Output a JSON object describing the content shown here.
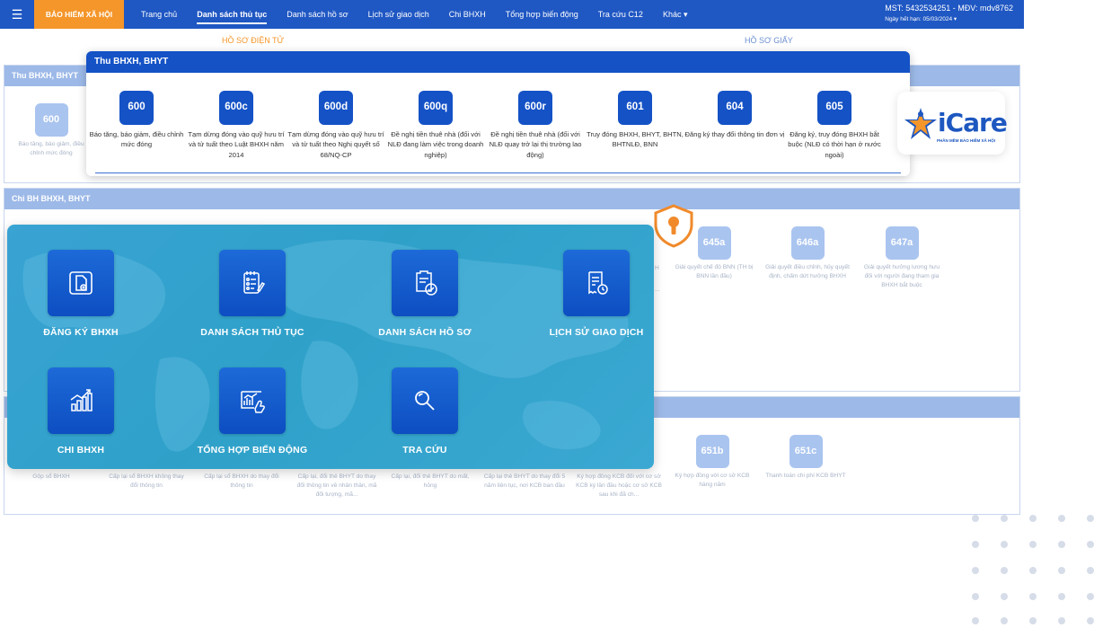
{
  "topbar": {
    "menu_icon": "hamburger-icon",
    "brand": "BẢO HIỂM XÃ HỘI",
    "nav": [
      "Trang chủ",
      "Danh sách thủ tục",
      "Danh sách hồ sơ",
      "Lịch sử giao dịch",
      "Chi BHXH",
      "Tổng hợp biến động",
      "Tra cứu C12",
      "Khác ▾"
    ],
    "active_nav": "Danh sách thủ tục",
    "account": "MST: 5432534251 - MĐV: mdv8762",
    "expiry": "Ngày hết hạn: 05/03/2024 ▾"
  },
  "doc_tabs": {
    "electronic": "HỒ SƠ ĐIỆN TỬ",
    "paper": "HỒ SƠ GIẤY"
  },
  "panels": {
    "thu_title": "Thu BHXH, BHYT",
    "chi_title": "Chi BH BHXH, BHYT",
    "bg_card_600": {
      "code": "600",
      "desc": "Báo tăng, báo giảm, điều chỉnh mức đóng"
    },
    "chi_cards": [
      {
        "code": "645a",
        "desc": "Giải quyết chế độ BNN (TH bị BNN lần đầu)"
      },
      {
        "code": "646a",
        "desc": "Giải quyết điều chỉnh, hủy quyết định, chấm dứt hưởng BHXH"
      },
      {
        "code": "647a",
        "desc": "Giải quyết hưởng lương hưu đối với người đang tham gia BHXH bắt buộc"
      }
    ],
    "chi_partial": "H",
    "chi_partial2": "...",
    "bottom_cards": [
      {
        "code": "",
        "desc": "Gộp sổ BHXH"
      },
      {
        "code": "",
        "desc": "Cấp lại sổ BHXH không thay đổi thông tin"
      },
      {
        "code": "",
        "desc": "Cấp lại sổ BHXH do thay đổi thông tin"
      },
      {
        "code": "",
        "desc": "Cấp lại, đổi thẻ BHYT do thay đổi thông tin về nhân thân, mã đối tượng, mã..."
      },
      {
        "code": "",
        "desc": "Cấp lại, đổi thẻ BHYT do mất, hỏng"
      },
      {
        "code": "",
        "desc": "Cấp lại thẻ BHYT do thay đổi 5 năm liên tục, nơi KCB ban đầu"
      },
      {
        "code": "",
        "desc": "Ký hợp đồng KCB đối với cơ sở KCB ký lần đầu hoặc cơ sở KCB sau khi đã ch..."
      },
      {
        "code": "651b",
        "desc": "Ký hợp đồng với cơ sở KCB hàng năm"
      },
      {
        "code": "651c",
        "desc": "Thanh toán chi phí KCB BHYT"
      }
    ]
  },
  "thu_overlay": {
    "title": "Thu BHXH, BHYT",
    "cards": [
      {
        "code": "600",
        "desc": "Báo tăng, báo giảm, điều chỉnh mức đóng"
      },
      {
        "code": "600c",
        "desc": "Tạm dừng đóng vào quỹ hưu trí và tử tuất theo Luật BHXH năm 2014"
      },
      {
        "code": "600d",
        "desc": "Tạm dừng đóng vào quỹ hưu trí và tử tuất theo Nghị quyết số 68/NQ-CP"
      },
      {
        "code": "600q",
        "desc": "Đề nghị tiền thuê nhà (đối với NLĐ đang làm việc trong doanh nghiệp)"
      },
      {
        "code": "600r",
        "desc": "Đề nghị tiền thuê nhà (đối với NLĐ quay trở lại thị trường lao động)"
      },
      {
        "code": "601",
        "desc": "Truy đóng BHXH, BHYT, BHTN, BHTNLĐ, BNN"
      },
      {
        "code": "604",
        "desc": "Đăng ký thay đổi thông tin đơn vị"
      },
      {
        "code": "605",
        "desc": "Đăng ký, truy đóng BHXH bắt buộc (NLĐ có thời hạn ở nước ngoài)"
      }
    ]
  },
  "logo": {
    "word": "iCare",
    "sub": "PHẦN MỀM BẢO HIỂM XÃ HỘI"
  },
  "dashboard": {
    "tiles": [
      {
        "label": "ĐĂNG KÝ BHXH",
        "icon": "document-add-icon"
      },
      {
        "label": "DANH SÁCH THỦ TỤC",
        "icon": "checklist-icon"
      },
      {
        "label": "DANH SÁCH HỒ SƠ",
        "icon": "clipboard-check-icon"
      },
      {
        "label": "LỊCH SỬ GIAO DỊCH",
        "icon": "receipt-clock-icon"
      },
      {
        "label": "CHI BHXH",
        "icon": "bar-chart-icon"
      },
      {
        "label": "TỔNG HỢP BIẾN ĐỘNG",
        "icon": "report-hand-icon"
      },
      {
        "label": "TRA CỨU",
        "icon": "search-icon"
      }
    ]
  },
  "colors": {
    "primary": "#1452c6",
    "brand_orange": "#f4962a",
    "dashboard_bg": "#35a2cf",
    "faint_badge": "#a9c4ef"
  }
}
